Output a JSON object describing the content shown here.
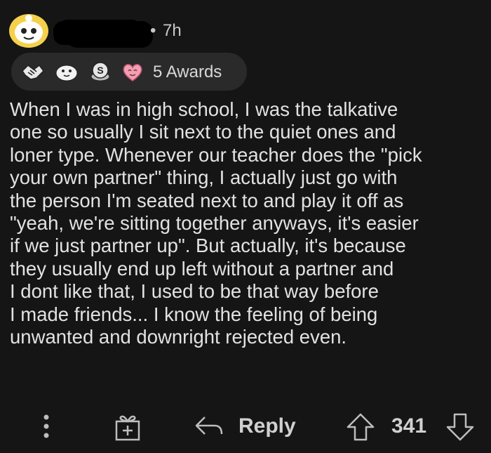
{
  "comment": {
    "time": "7h",
    "separator": "•",
    "awards_label": "5 Awards",
    "award_icons": [
      "handshake-award-icon",
      "wholesome-seal-award-icon",
      "silver-coin-award-icon",
      "heart-eyes-award-icon"
    ],
    "body": "When I was in high school, I was the talkative\none so usually I sit next to the quiet ones and\nloner type. Whenever our teacher does the \"pick\nyour own partner\" thing, I actually just go with\nthe person I'm seated next to and play it off as\n\"yeah, we're sitting together anyways, it's easier\nif we just partner up\". But actually, it's because\nthey usually end up left without a partner and\nI dont like that, I used to be that way before\nI made friends... I know the feeling of being\nunwanted and downright rejected even."
  },
  "actions": {
    "reply_label": "Reply",
    "score": "341"
  },
  "colors": {
    "background": "#151515",
    "text": "#e2e2e2",
    "pill": "#2a2a2a",
    "avatar_yellow": "#f5d04a"
  }
}
